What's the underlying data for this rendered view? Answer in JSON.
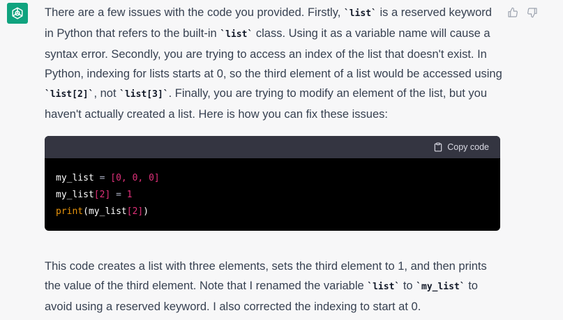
{
  "avatar": {
    "icon": "openai-logo-icon",
    "color": "#10a37f"
  },
  "feedback": {
    "thumbs_up": "thumbs-up-icon",
    "thumbs_down": "thumbs-down-icon"
  },
  "intro": {
    "t1": "There are a few issues with the code you provided. Firstly, ",
    "c1": "`list`",
    "t2": " is a reserved keyword in Python that refers to the built-in ",
    "c2": "`list`",
    "t3": " class. Using it as a variable name will cause a syntax error. Secondly, you are trying to access an index of the list that doesn't exist. In Python, indexing for lists starts at 0, so the third element of a list would be accessed using ",
    "c3": "`list[2]`",
    "t4": ", not ",
    "c4": "`list[3]`",
    "t5": ". Finally, you are trying to modify an element of the list, but you haven't actually created a list. Here is how you can fix these issues:"
  },
  "code": {
    "copy_label": "Copy code",
    "line1": {
      "var": "my_list",
      "op": " = ",
      "value": "[0, 0, 0]"
    },
    "line2": {
      "var": "my_list",
      "index": "[2]",
      "op": " = ",
      "value": "1"
    },
    "line3": {
      "fn": "print",
      "open": "(",
      "var": "my_list",
      "index": "[2]",
      "close": ")"
    }
  },
  "outro": {
    "t1": "This code creates a list with three elements, sets the third element to 1, and then prints the value of the third element. Note that I renamed the variable ",
    "c1": "`list`",
    "t2": " to ",
    "c2": "`my_list`",
    "t3": " to avoid using a reserved keyword. I also corrected the indexing to start at 0."
  }
}
